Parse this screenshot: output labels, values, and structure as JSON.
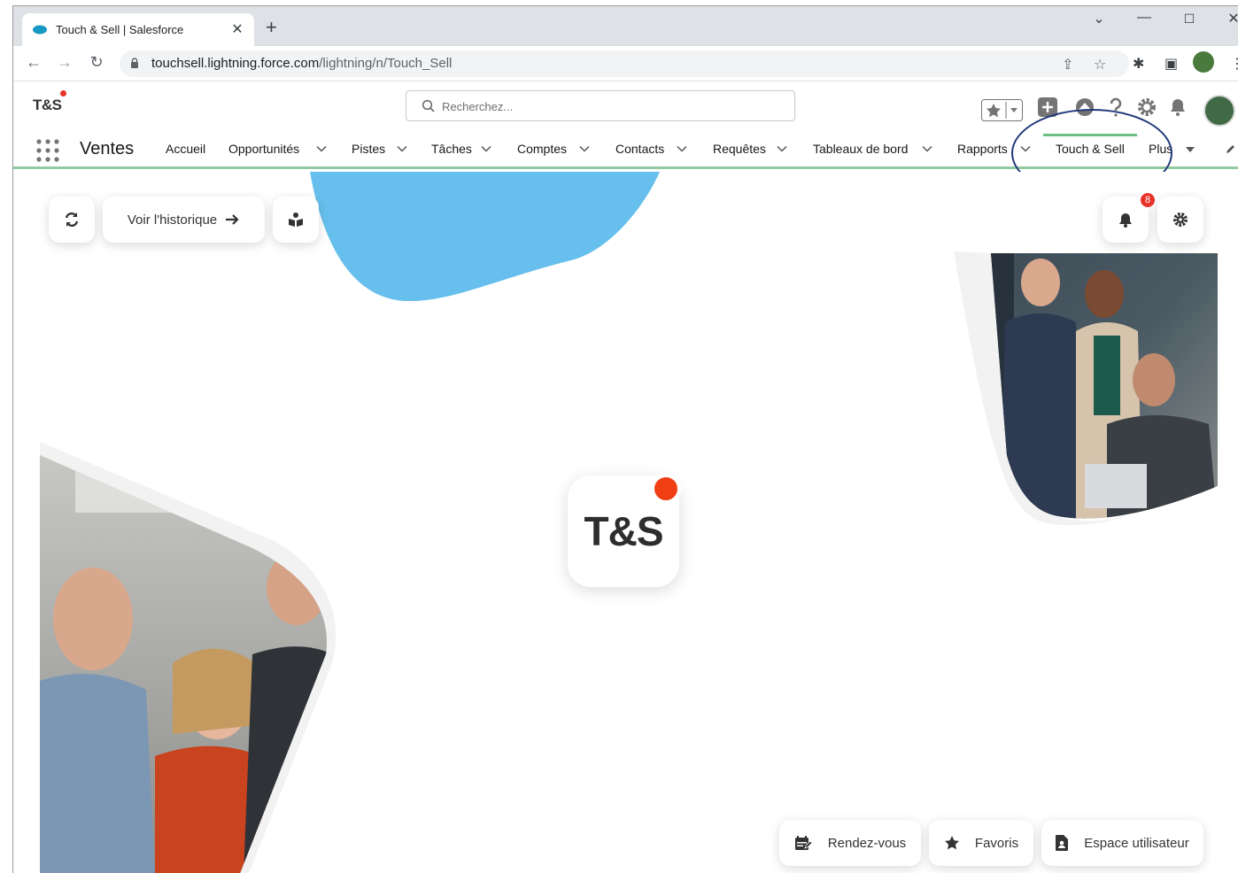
{
  "browser": {
    "tab_title": "Touch & Sell | Salesforce",
    "url_host": "touchsell.lightning.force.com",
    "url_path": "/lightning/n/Touch_Sell"
  },
  "header": {
    "logo_text": "T&S",
    "search_placeholder": "Recherchez..."
  },
  "nav": {
    "app_name": "Ventes",
    "items": [
      {
        "label": "Accueil"
      },
      {
        "label": "Opportunités"
      },
      {
        "label": "Pistes"
      },
      {
        "label": "Tâches"
      },
      {
        "label": "Comptes"
      },
      {
        "label": "Contacts"
      },
      {
        "label": "Requêtes"
      },
      {
        "label": "Tableaux de bord"
      },
      {
        "label": "Rapports"
      },
      {
        "label": "Touch & Sell"
      },
      {
        "label": "Plus"
      }
    ],
    "active_item": "Touch & Sell"
  },
  "toolbar": {
    "history_label": "Voir l'historique"
  },
  "notifications": {
    "count": "8"
  },
  "center_logo": {
    "text": "T&S"
  },
  "bottom_actions": {
    "appointments_label": "Rendez-vous",
    "favorites_label": "Favoris",
    "user_space_label": "Espace utilisateur"
  },
  "colors": {
    "accent_blob": "#66bfec",
    "notification_dot": "#f04013",
    "badge": "#e8332a",
    "nav_underline": "#92c9a0",
    "annotation_circle": "#1f3a7a"
  },
  "icons": [
    "salesforce-cloud-icon",
    "lock-icon",
    "search-icon",
    "refresh-icon",
    "arrow-right-icon",
    "book-reader-icon",
    "bell-icon",
    "gear-icon",
    "calendar-edit-icon",
    "star-icon",
    "file-user-icon"
  ]
}
